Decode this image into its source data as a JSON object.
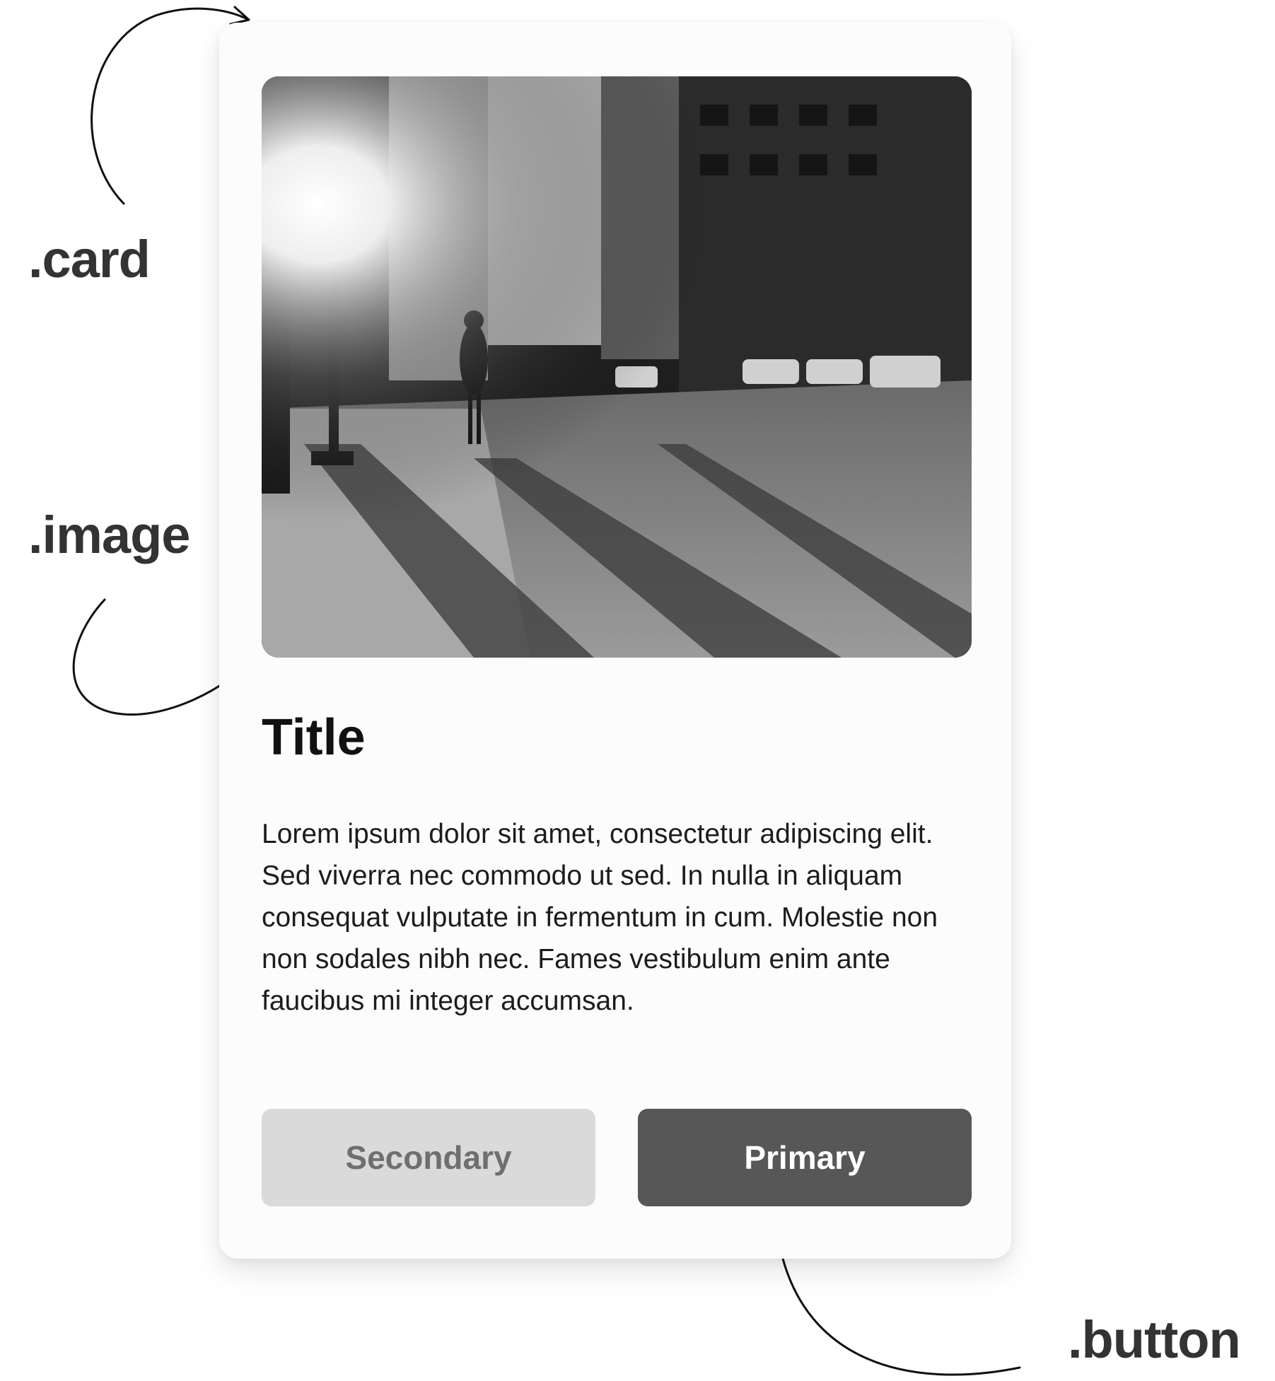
{
  "annotations": {
    "card": ".card",
    "image": ".image",
    "button": ".button"
  },
  "card": {
    "title": "Title",
    "body": "Lorem ipsum dolor sit amet, consectetur adipiscing elit. Sed viverra nec commodo ut sed. In nulla in aliquam consequat vulputate in fermentum in cum. Molestie non non sodales nibh nec. Fames vestibulum enim ante faucibus mi integer accumsan.",
    "secondary_label": "Secondary",
    "primary_label": "Primary",
    "image_icon": "city-street-photo"
  },
  "colors": {
    "card_background": "#fcfcfc",
    "secondary_button": "#dadada",
    "secondary_text": "#6f6f6f",
    "primary_button": "#575757",
    "primary_text": "#ffffff",
    "annotation_text": "#333333"
  }
}
